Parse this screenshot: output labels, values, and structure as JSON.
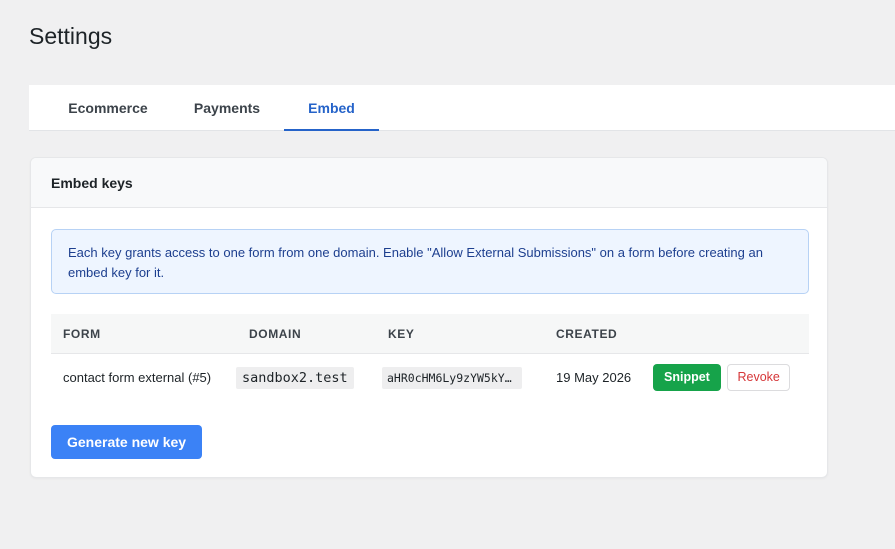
{
  "page": {
    "title": "Settings"
  },
  "tabs": [
    {
      "label": "Ecommerce",
      "active": false
    },
    {
      "label": "Payments",
      "active": false
    },
    {
      "label": "Embed",
      "active": true
    }
  ],
  "card": {
    "title": "Embed keys",
    "notice": "Each key grants access to one form from one domain. Enable \"Allow External Submissions\" on a form before creating an embed key for it.",
    "table": {
      "columns": [
        "FORM",
        "DOMAIN",
        "KEY",
        "CREATED"
      ],
      "rows": [
        {
          "form": "contact form external (#5)",
          "domain": "sandbox2.test",
          "key": "aHR0cHM6Ly9zYW5kY…",
          "created": "19 May 2026",
          "actions": {
            "snippet": "Snippet",
            "revoke": "Revoke"
          }
        }
      ]
    },
    "generate_label": "Generate new key"
  },
  "colors": {
    "accent": "#2563c9",
    "primary_button": "#3b82f6",
    "success_button": "#16a34a",
    "danger_text": "#d63638",
    "notice_bg": "#eef5ff"
  }
}
